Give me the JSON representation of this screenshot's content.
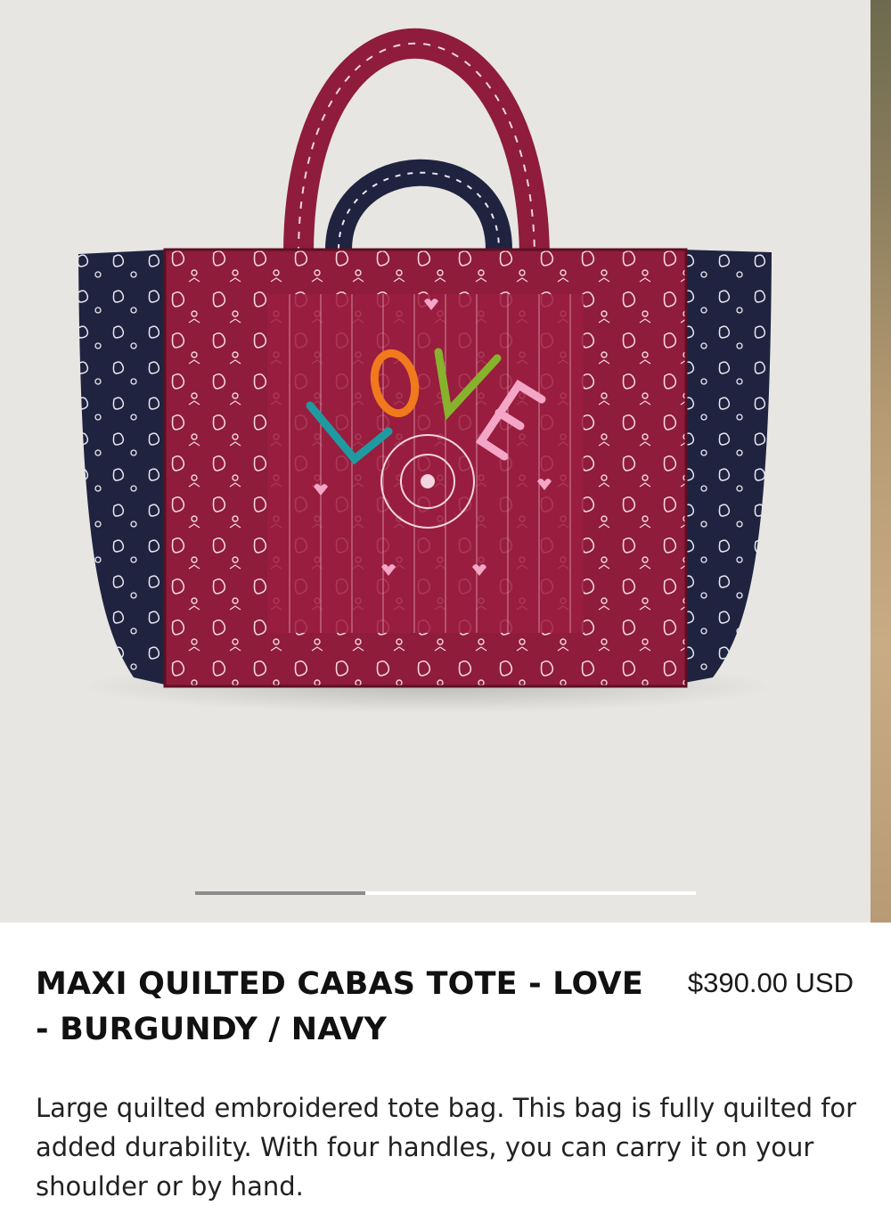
{
  "gallery": {
    "image_alt": "Maxi quilted cabas tote bag, burgundy and navy bandana print with LOVE embroidery",
    "embroidery_text": "LOVE",
    "slide_progress": 0.34,
    "colors": {
      "burgundy": "#8e1c3a",
      "navy": "#1f2340",
      "background": "#e8e6e2"
    }
  },
  "product": {
    "title": "MAXI QUILTED CABAS TOTE - LOVE - BURGUNDY / NAVY",
    "price": "$390.00 USD",
    "description": "Large quilted embroidered tote bag. This bag is fully quilted for added durability. With four handles, you can carry it on your shoulder or by hand."
  }
}
